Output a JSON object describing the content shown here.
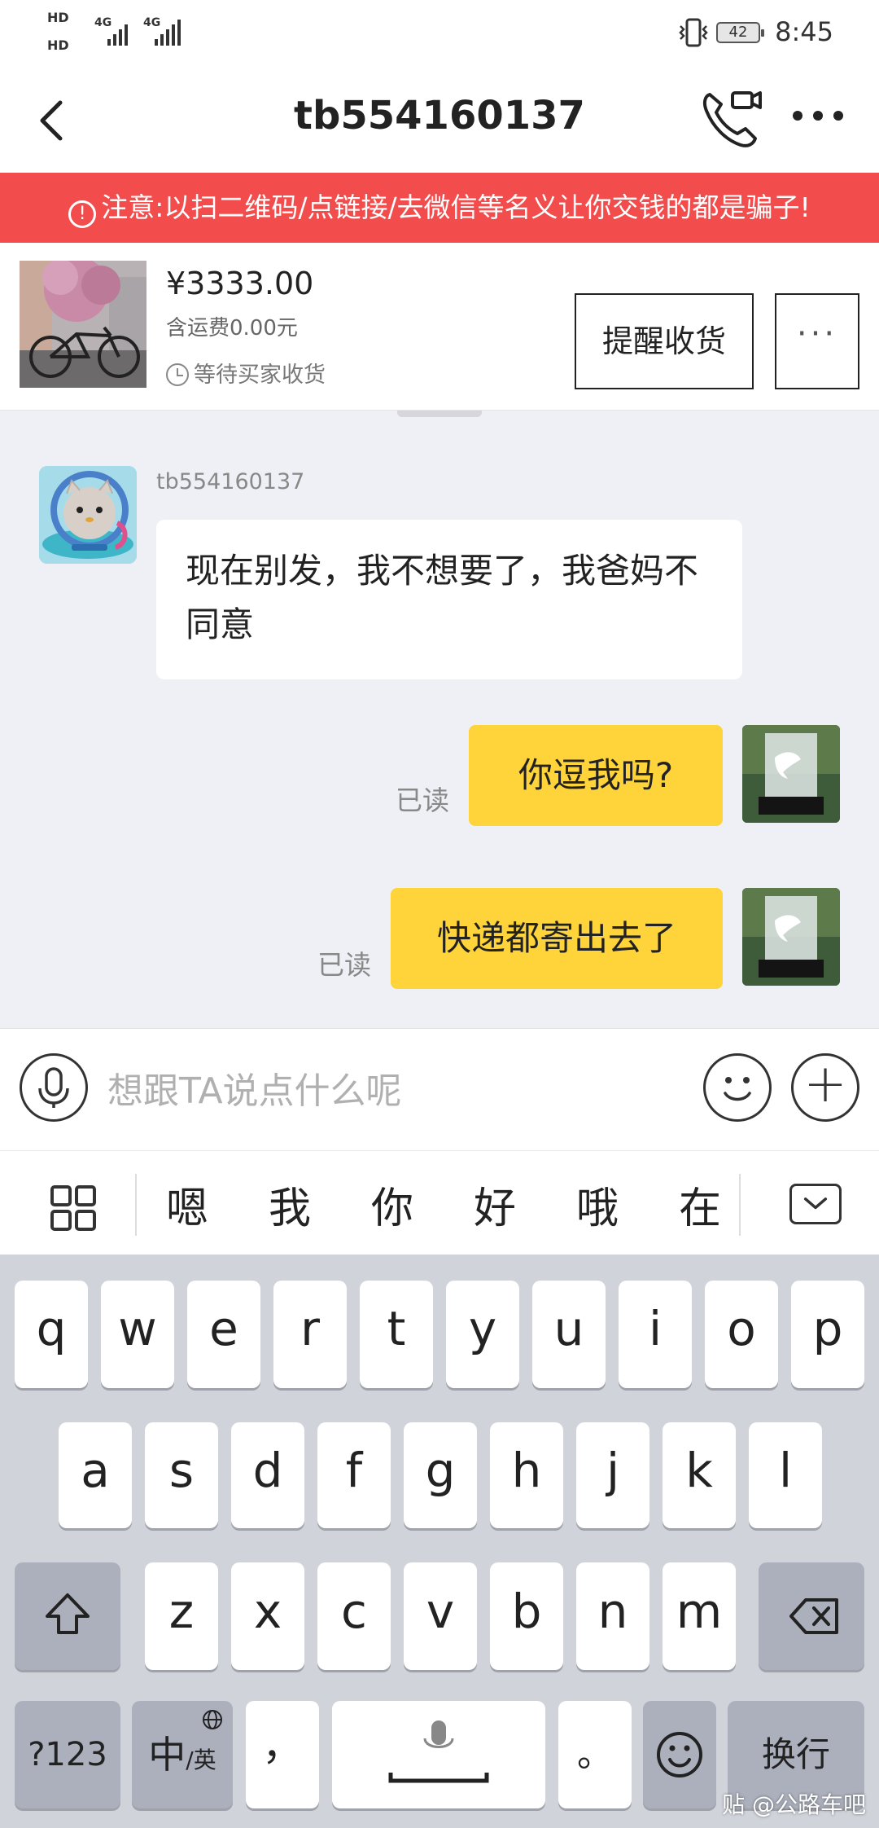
{
  "status_bar": {
    "hd1": "HD",
    "hd2": "HD",
    "net1": "4G",
    "net2": "4G",
    "battery": "42",
    "time": "8:45"
  },
  "header": {
    "title": "tb554160137",
    "back_icon": "chevron-left-icon",
    "call_icon": "phone-video-icon",
    "more_icon": "more-dots-icon"
  },
  "warning": {
    "text": "注意:以扫二维码/点链接/去微信等名义让你交钱的都是骗子!"
  },
  "order": {
    "price": "¥3333.00",
    "shipping": "含运费0.00元",
    "status": "等待买家收货",
    "remind_label": "提醒收货",
    "more_label": "···"
  },
  "chat": {
    "peer_name": "tb554160137",
    "messages": [
      {
        "from": "peer",
        "text": "现在别发，我不想要了，我爸妈不同意"
      },
      {
        "from": "me",
        "text": "你逗我吗?",
        "status": "已读"
      },
      {
        "from": "me",
        "text": "快递都寄出去了",
        "status": "已读"
      }
    ]
  },
  "input": {
    "placeholder": "想跟TA说点什么呢"
  },
  "candidates": [
    "嗯",
    "我",
    "你",
    "好",
    "哦",
    "在"
  ],
  "keyboard": {
    "row1": [
      "q",
      "w",
      "e",
      "r",
      "t",
      "y",
      "u",
      "i",
      "o",
      "p"
    ],
    "row2": [
      "a",
      "s",
      "d",
      "f",
      "g",
      "h",
      "j",
      "k",
      "l"
    ],
    "row3": [
      "z",
      "x",
      "c",
      "v",
      "b",
      "n",
      "m"
    ],
    "num_key": "?123",
    "lang_key_main": "中",
    "lang_key_sub": "/英",
    "comma_key": "，",
    "period_key": "。",
    "enter_key": "换行"
  },
  "watermark": "贴 @公路车吧",
  "colors": {
    "warning_bg": "#f24c4c",
    "my_bubble": "#ffd43b",
    "chat_bg": "#eff0f5",
    "keyboard_bg": "#d1d3db"
  }
}
